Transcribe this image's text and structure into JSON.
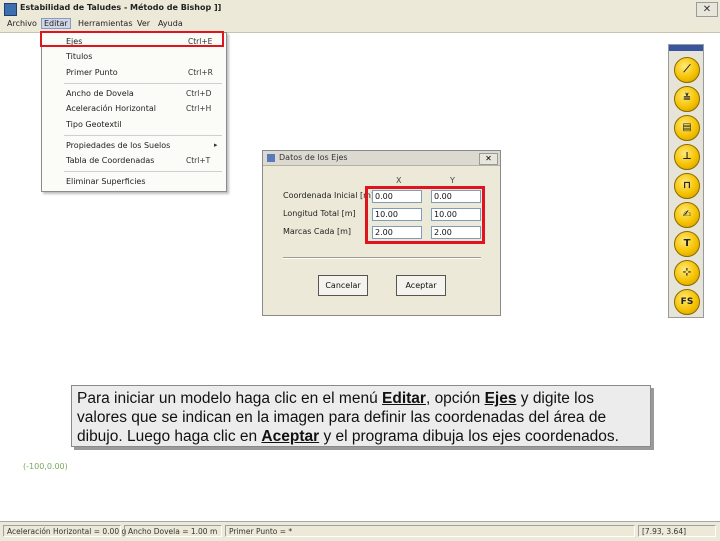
{
  "window": {
    "title": "Estabilidad de Taludes - Método de Bishop ]]",
    "close_glyph": "✕"
  },
  "menubar": {
    "items": [
      "Archivo",
      "Editar",
      "Herramientas",
      "Ver",
      "Ayuda"
    ]
  },
  "edit_menu": {
    "items": [
      {
        "label": "Ejes",
        "shortcut": "Ctrl+E"
      },
      {
        "label": "Titulos",
        "shortcut": ""
      },
      {
        "label": "Primer Punto",
        "shortcut": "Ctrl+R"
      },
      {
        "label": "Ancho de Dovela",
        "shortcut": "Ctrl+D"
      },
      {
        "label": "Aceleración Horizontal",
        "shortcut": "Ctrl+H"
      },
      {
        "label": "Tipo Geotextil",
        "shortcut": ""
      },
      {
        "label": "Propiedades de los Suelos",
        "shortcut": "▸"
      },
      {
        "label": "Tabla de Coordenadas",
        "shortcut": "Ctrl+T"
      },
      {
        "label": "Eliminar Superficies",
        "shortcut": ""
      }
    ]
  },
  "toolbar": {
    "icons": [
      "slope-icon",
      "scale-icon",
      "grid-icon",
      "layers-icon",
      "bracket-icon",
      "hand-icon",
      "text-icon",
      "axis-icon",
      "fs-icon"
    ],
    "glyphs": [
      "⟋",
      "≚",
      "▤",
      "⊥",
      "⊓",
      "✍",
      "T",
      "⊹",
      "FS"
    ],
    "accent": "#f5c200"
  },
  "dialog": {
    "title": "Datos de los Ejes",
    "col_x": "X",
    "col_y": "Y",
    "rows": [
      {
        "label": "Coordenada Inicial [m]",
        "x": "0.00",
        "y": "0.00"
      },
      {
        "label": "Longitud Total [m]",
        "x": "10.00",
        "y": "10.00"
      },
      {
        "label": "Marcas Cada [m]",
        "x": "2.00",
        "y": "2.00"
      }
    ],
    "cancel_label": "Cancelar",
    "accept_label": "Aceptar",
    "close_glyph": "✕"
  },
  "caption": {
    "part1": "Para iniciar un modelo haga clic en el menú ",
    "editar": "Editar",
    "part2": ", opción ",
    "ejes": "Ejes",
    "part3": " y digite los valores que se indican en la imagen para definir las coordenadas del área de dibujo. Luego haga clic en ",
    "aceptar": "Aceptar",
    "part4": " y el programa dibuja los ejes coordenados."
  },
  "canvas": {
    "origin_label": "(-100,0.00)"
  },
  "statusbar": {
    "horizontal_accel": "Aceleración Horizontal = 0.00 g",
    "slice_width": "Ancho Dovela = 1.00 m",
    "first_point": "Primer Punto = *",
    "coords": "[7.93, 3.64]"
  },
  "highlight_color": "#e0141e"
}
